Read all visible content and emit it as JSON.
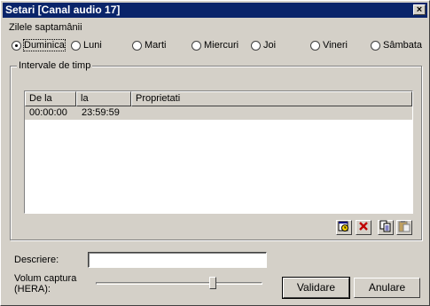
{
  "window": {
    "title": "Setari [Canal audio 17]",
    "close_glyph": "×"
  },
  "days": {
    "label": "Zilele saptamânii",
    "items": [
      {
        "label": "Duminica",
        "selected": true
      },
      {
        "label": "Luni",
        "selected": false
      },
      {
        "label": "Marti",
        "selected": false
      },
      {
        "label": "Miercuri",
        "selected": false
      },
      {
        "label": "Joi",
        "selected": false
      },
      {
        "label": "Vineri",
        "selected": false
      },
      {
        "label": "Sâmbata",
        "selected": false
      }
    ]
  },
  "intervals": {
    "label": "Intervale de timp",
    "columns": [
      "De la",
      "la",
      "Proprietati"
    ],
    "rows": [
      [
        "00:00:00",
        "23:59:59",
        ""
      ]
    ],
    "toolbar": [
      "add-interval-icon",
      "delete-icon",
      "copy-icon",
      "paste-icon"
    ]
  },
  "description": {
    "label": "Descriere:",
    "value": ""
  },
  "volume": {
    "label": "Volum captura\n(HERA):",
    "level": 0.71
  },
  "buttons": {
    "ok": "Validare",
    "cancel": "Anulare"
  }
}
